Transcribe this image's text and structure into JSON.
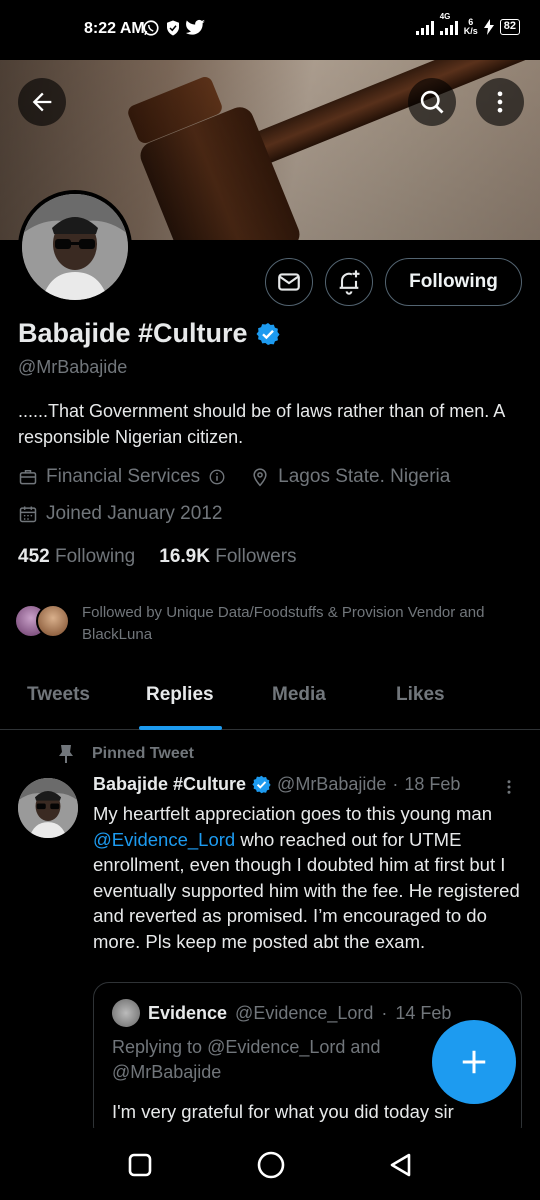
{
  "status_bar": {
    "time": "8:22 AM",
    "network_label_1": "4G",
    "speed_value": "6",
    "speed_unit": "K/s",
    "battery": "82"
  },
  "header": {
    "back_icon": "arrow-left-icon",
    "search_icon": "search-icon",
    "more_icon": "more-vertical-icon"
  },
  "profile": {
    "name": "Babajide #Culture",
    "handle": "@MrBabajide",
    "bio": "......That Government should be of laws rather than of men. A responsible Nigerian citizen.",
    "category": "Financial Services",
    "location": "Lagos State. Nigeria",
    "joined": "Joined January 2012",
    "following_count": "452",
    "following_label": "Following",
    "followers_count": "16.9K",
    "followers_label": "Followers",
    "followed_by": "Followed by Unique Data/Foodstuffs & Provision Vendor and BlackLuna",
    "following_button": "Following",
    "verified_color": "#1d9bf0"
  },
  "tabs": [
    {
      "label": "Tweets"
    },
    {
      "label": "Replies",
      "active": true
    },
    {
      "label": "Media"
    },
    {
      "label": "Likes"
    }
  ],
  "pinned_tweet": {
    "pinned_label": "Pinned Tweet",
    "author_name": "Babajide #Culture",
    "author_handle": "@MrBabajide",
    "date": "18 Feb",
    "text_before_mention": "My heartfelt appreciation goes to this young man ",
    "mention": "@Evidence_Lord",
    "text_after_mention": " who reached out for UTME enrollment, even though I doubted him at first but I eventually supported him with the fee. He registered and reverted as promised. I’m encouraged to do more. Pls keep me posted abt the exam.",
    "quote": {
      "author_name": "Evidence",
      "author_handle": "@Evidence_Lord",
      "date": "14 Feb",
      "replying_prefix": "Replying to ",
      "replying_to_1": "@Evidence_Lord",
      "replying_and": " and ",
      "replying_to_2": "@MrBabajide",
      "text": "I'm very grateful for what you did today sir"
    }
  },
  "colors": {
    "accent": "#1d9bf0",
    "muted": "#71767b",
    "border": "#2f3336"
  }
}
